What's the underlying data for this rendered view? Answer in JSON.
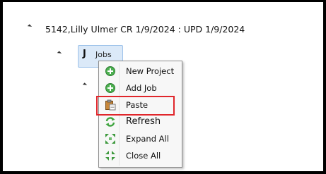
{
  "tree": {
    "root_label": "5142,Lilly Ulmer CR 1/9/2024 : UPD 1/9/2024",
    "child_icon": "J",
    "child_label": "Jobs"
  },
  "context_menu": {
    "items": [
      {
        "label": "New Project",
        "icon": "green-plus-circle-icon"
      },
      {
        "label": "Add Job",
        "icon": "green-plus-circle-icon"
      },
      {
        "label": "Paste",
        "icon": "clipboard-paste-icon"
      },
      {
        "label": "Refresh",
        "icon": "green-refresh-icon"
      },
      {
        "label": "Expand All",
        "icon": "expand-arrows-icon"
      },
      {
        "label": "Close All",
        "icon": "collapse-arrows-icon"
      }
    ],
    "highlighted_item": "Paste",
    "highlight_color": "#e0262b"
  }
}
